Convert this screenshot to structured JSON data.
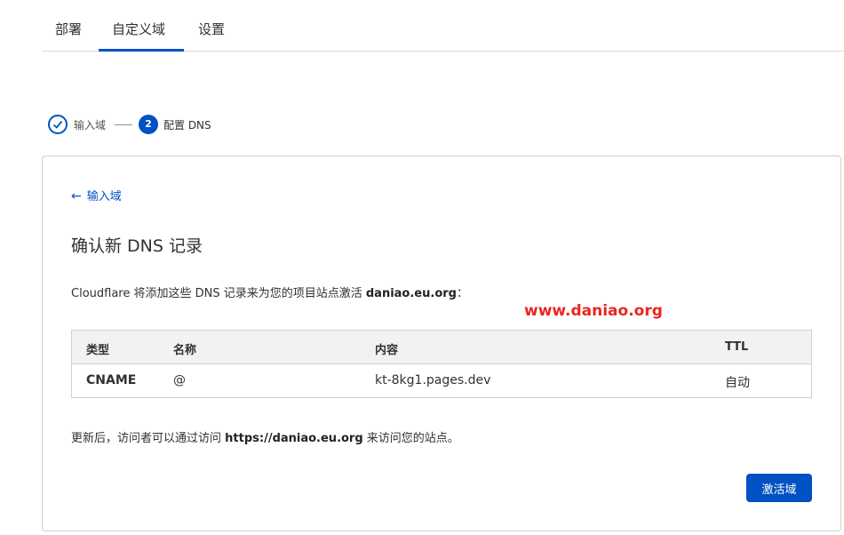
{
  "tabs": [
    {
      "label": "部署"
    },
    {
      "label": "自定义域"
    },
    {
      "label": "设置"
    }
  ],
  "stepper": {
    "step1_label": "输入域",
    "step2_number": "2",
    "step2_label": "配置 DNS"
  },
  "card": {
    "back_label": "输入域",
    "title": "确认新 DNS 记录",
    "desc_prefix": "Cloudflare 将添加这些 DNS 记录来为您的项目站点激活 ",
    "desc_domain": "daniao.eu.org",
    "desc_suffix": "：",
    "watermark": "www.daniao.org",
    "table": {
      "headers": {
        "type": "类型",
        "name": "名称",
        "content": "内容",
        "ttl": "TTL"
      },
      "rows": [
        {
          "type": "CNAME",
          "name": "@",
          "content": "kt-8kg1.pages.dev",
          "ttl": "自动"
        }
      ]
    },
    "note_prefix": "更新后，访问者可以通过访问 ",
    "note_url": "https://daniao.eu.org",
    "note_suffix": " 来访问您的站点。",
    "activate_label": "激活域"
  },
  "colors": {
    "accent": "#0051c3",
    "watermark": "#e8271d"
  }
}
